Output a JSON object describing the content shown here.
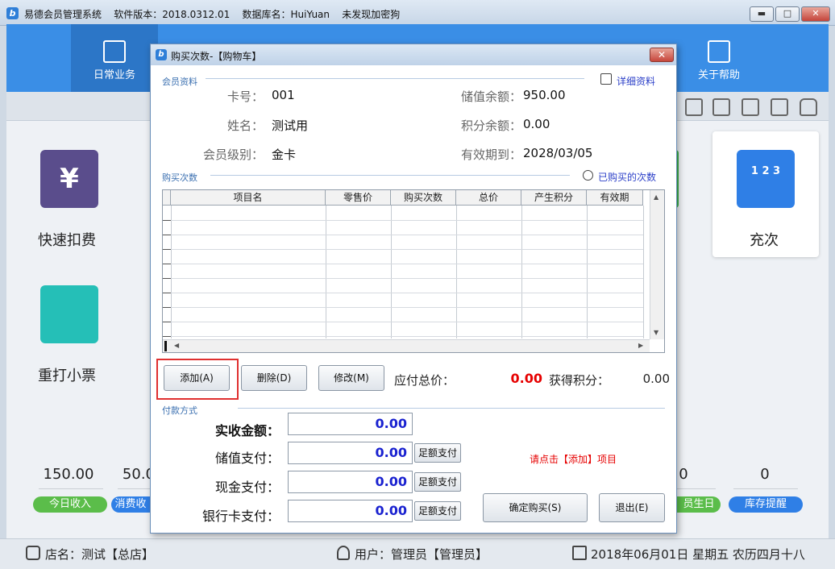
{
  "window": {
    "app_name": "易德会员管理系统",
    "version_label": "软件版本：2018.0312.01",
    "db_label": "数据库名：HuiYuan",
    "key_status": "未发现加密狗",
    "app_icon": "app-logo-icon",
    "min_glyph": "▬",
    "max_glyph": "□",
    "close_glyph": "✕"
  },
  "nav": {
    "active_label": "日常业务",
    "help_label": "关于帮助"
  },
  "tiles": {
    "quick_charge": "快速扣费",
    "quick_charge_glyph": "¥",
    "reprint": "重打小票",
    "recharge_count": "充次",
    "recharge_count_glyph": "1 2 3"
  },
  "stats": {
    "today_income_value": "150.00",
    "today_income_label": "今日收入",
    "consume_value": "50.0",
    "consume_label": "消费收",
    "birthday_value": "0",
    "birthday_label": "员生日",
    "stock_value": "0",
    "stock_label": "库存提醒"
  },
  "statusbar": {
    "store": "店名：测试【总店】",
    "user": "用户：管理员【管理员】",
    "date": "2018年06月01日 星期五 农历四月十八"
  },
  "dialog": {
    "title": "购买次数-【购物车】",
    "close_glyph": "✕",
    "member_section": "会员资料",
    "detail_link": "详细资料",
    "card_no_label": "卡号：",
    "card_no": "001",
    "balance_label": "储值余额：",
    "balance": "950.00",
    "name_label": "姓名：",
    "name": "测试用",
    "points_label": "积分余额：",
    "points": "0.00",
    "level_label": "会员级别：",
    "level": "金卡",
    "expire_label": "有效期到：",
    "expire": "2028/03/05",
    "purchase_section": "购买次数",
    "purchased_link": "已购买的次数",
    "columns": [
      "项目名",
      "零售价",
      "购买次数",
      "总价",
      "产生积分",
      "有效期"
    ],
    "add_button": "添加(A)",
    "delete_button": "删除(D)",
    "edit_button": "修改(M)",
    "total_due_label": "应付总价：",
    "total_due": "0.00",
    "earn_points_label": "获得积分：",
    "earn_points": "0.00",
    "payment_section": "付款方式",
    "paid_label": "实收金额：",
    "paid_value": "0.00",
    "stored_label": "储值支付：",
    "stored_value": "0.00",
    "cash_label": "现金支付：",
    "cash_value": "0.00",
    "bank_label": "银行卡支付：",
    "bank_value": "0.00",
    "full_pay": "足额支付",
    "hint": "请点击【添加】项目",
    "confirm_button": "确定购买(S)",
    "exit_button": "退出(E)"
  },
  "colors": {
    "nav_blue": "#3a8ee6",
    "total_red": "#e60000",
    "input_blue": "#1a22d0",
    "highlight_box": "#e03030"
  }
}
